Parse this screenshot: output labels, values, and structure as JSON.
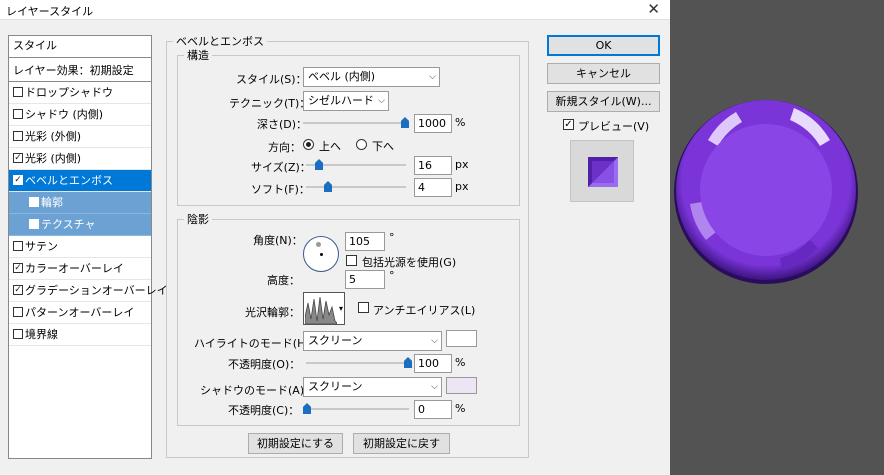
{
  "window": {
    "title": "レイヤースタイル",
    "close_glyph": "✕"
  },
  "styles_panel": {
    "header": "スタイル",
    "default": "レイヤー効果：初期設定",
    "items": [
      {
        "label": "ドロップシャドウ",
        "checked": false
      },
      {
        "label": "シャドウ (内側)",
        "checked": false
      },
      {
        "label": "光彩 (外側)",
        "checked": false
      },
      {
        "label": "光彩 (内側)",
        "checked": true
      },
      {
        "label": "ベベルとエンボス",
        "checked": true,
        "selected": true
      },
      {
        "label": "輪郭",
        "checked": false,
        "sub": true
      },
      {
        "label": "テクスチャ",
        "checked": false,
        "sub": true
      },
      {
        "label": "サテン",
        "checked": false
      },
      {
        "label": "カラーオーバーレイ",
        "checked": true
      },
      {
        "label": "グラデーションオーバーレイ",
        "checked": true
      },
      {
        "label": "パターンオーバーレイ",
        "checked": false
      },
      {
        "label": "境界線",
        "checked": false
      }
    ]
  },
  "bevel": {
    "section_title": "ベベルとエンボス",
    "structure_title": "構造",
    "style_label": "スタイル(S)：",
    "style_value": "ベベル (内側)",
    "technique_label": "テクニック(T)：",
    "technique_value": "シゼルハード",
    "depth_label": "深さ(D)：",
    "depth_value": "1000",
    "depth_unit": "%",
    "depth_level": 1.0,
    "direction_label": "方向：",
    "direction_up": "上へ",
    "direction_down": "下へ",
    "size_label": "サイズ(Z)：",
    "size_value": "16",
    "size_unit": "px",
    "size_level": 0.1,
    "soften_label": "ソフト(F)：",
    "soften_value": "4",
    "soften_unit": "px",
    "soften_level": 0.2
  },
  "shading": {
    "title": "陰影",
    "angle_label": "角度(N)：",
    "angle_value": "105",
    "degree": "°",
    "global_light_label": "包括光源を使用(G)",
    "altitude_label": "高度：",
    "altitude_value": "5",
    "gloss_label": "光沢輪郭：",
    "antialias_label": "アンチエイリアス(L)",
    "highlight_mode_label": "ハイライトのモード(H)：",
    "highlight_mode_value": "スクリーン",
    "highlight_color": "#ffffff",
    "highlight_opacity_label": "不透明度(O)：",
    "highlight_opacity_value": "100",
    "highlight_opacity_level": 1.0,
    "shadow_mode_label": "シャドウのモード(A)：",
    "shadow_mode_value": "スクリーン",
    "shadow_color": "#ece6f4",
    "shadow_opacity_label": "不透明度(C)：",
    "shadow_opacity_value": "0",
    "shadow_opacity_level": 0.0,
    "percent": "%"
  },
  "buttons": {
    "make_default": "初期設定にする",
    "reset_default": "初期設定に戻す",
    "ok": "OK",
    "cancel": "キャンセル",
    "new_style": "新規スタイル(W)...",
    "preview": "プレビュー(V)"
  },
  "colors": {
    "selection": "#0078d7",
    "sub_selection": "#6ba2d3",
    "slider_thumb": "#1c6fc0",
    "canvas_bg": "#535353",
    "button_purple": "#8a45e6"
  }
}
